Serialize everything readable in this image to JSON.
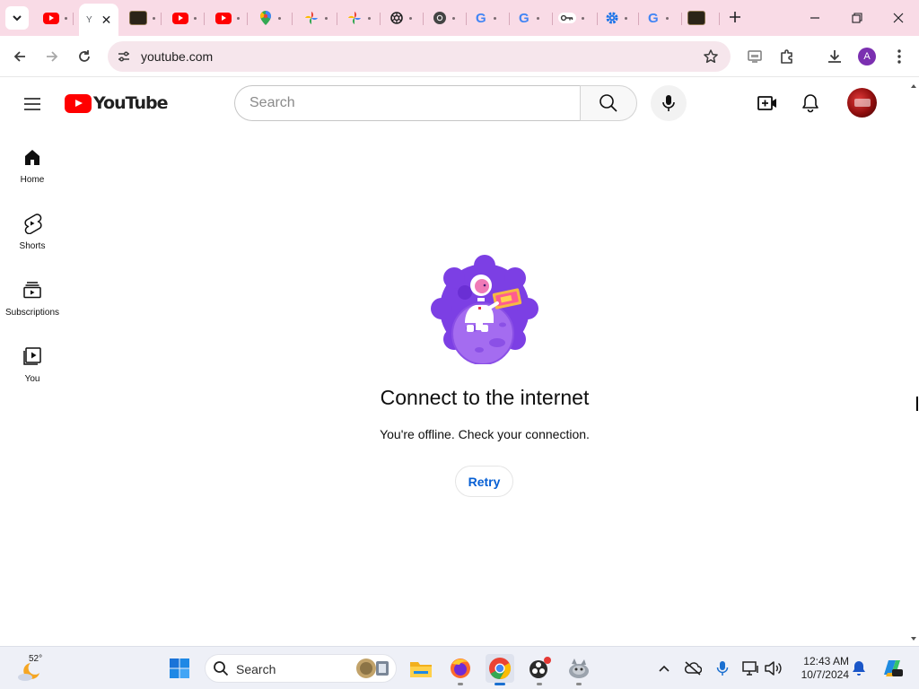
{
  "browser": {
    "tabs": [
      {
        "name": "tab-youtube-1",
        "icon": "youtube-favicon-icon",
        "color": "#ff0000"
      },
      {
        "name": "tab-youtube-active",
        "icon": "youtube-favicon-icon",
        "active": true
      },
      {
        "name": "tab-dark-site-1",
        "icon": "dark-thumbnail-icon",
        "color": "#3a2e1f"
      },
      {
        "name": "tab-youtube-2",
        "icon": "youtube-favicon-icon",
        "color": "#ff0000"
      },
      {
        "name": "tab-youtube-3",
        "icon": "youtube-favicon-icon",
        "color": "#ff0000"
      },
      {
        "name": "tab-google-maps",
        "icon": "maps-pin-icon"
      },
      {
        "name": "tab-google-photos-1",
        "icon": "photos-pinwheel-icon"
      },
      {
        "name": "tab-google-photos-2",
        "icon": "photos-pinwheel-icon"
      },
      {
        "name": "tab-openai",
        "icon": "openai-knot-icon"
      },
      {
        "name": "tab-chrome",
        "icon": "chrome-logo-icon"
      },
      {
        "name": "tab-google-1",
        "icon": "google-g-icon"
      },
      {
        "name": "tab-google-2",
        "icon": "google-g-icon"
      },
      {
        "name": "tab-password-manager",
        "icon": "key-icon"
      },
      {
        "name": "tab-settings",
        "icon": "gear-icon",
        "color": "#1a73e8"
      },
      {
        "name": "tab-google-3",
        "icon": "google-g-icon"
      },
      {
        "name": "tab-dark-site-2",
        "icon": "dark-thumbnail-icon",
        "color": "#3a2e1f"
      }
    ],
    "active_tab_partial_title": "Y",
    "url": "youtube.com",
    "profile_initial": "A",
    "profile_color": "#7b2fb0",
    "tabstrip_color": "#f9dbe6"
  },
  "youtube": {
    "logo_text": "YouTube",
    "search_placeholder": "Search",
    "guide": [
      {
        "label": "Home",
        "icon": "home-icon"
      },
      {
        "label": "Shorts",
        "icon": "shorts-icon"
      },
      {
        "label": "Subscriptions",
        "icon": "subscriptions-icon"
      },
      {
        "label": "You",
        "icon": "you-library-icon"
      }
    ],
    "offline": {
      "title": "Connect to the internet",
      "message": "You're offline. Check your connection.",
      "retry_label": "Retry",
      "illustration": "astronaut-on-planet-illustration"
    },
    "accent_color": "#ff0000",
    "link_color": "#065fd4"
  },
  "taskbar": {
    "weather_temp": "52°",
    "search_label": "Search",
    "apps": [
      {
        "name": "file-explorer",
        "icon": "folder-icon"
      },
      {
        "name": "firefox",
        "icon": "firefox-icon"
      },
      {
        "name": "chrome",
        "icon": "chrome-logo-icon",
        "active": true
      },
      {
        "name": "obs-studio",
        "icon": "obs-icon"
      },
      {
        "name": "gimp",
        "icon": "gimp-icon"
      }
    ],
    "time": "12:43 AM",
    "date": "10/7/2024"
  }
}
